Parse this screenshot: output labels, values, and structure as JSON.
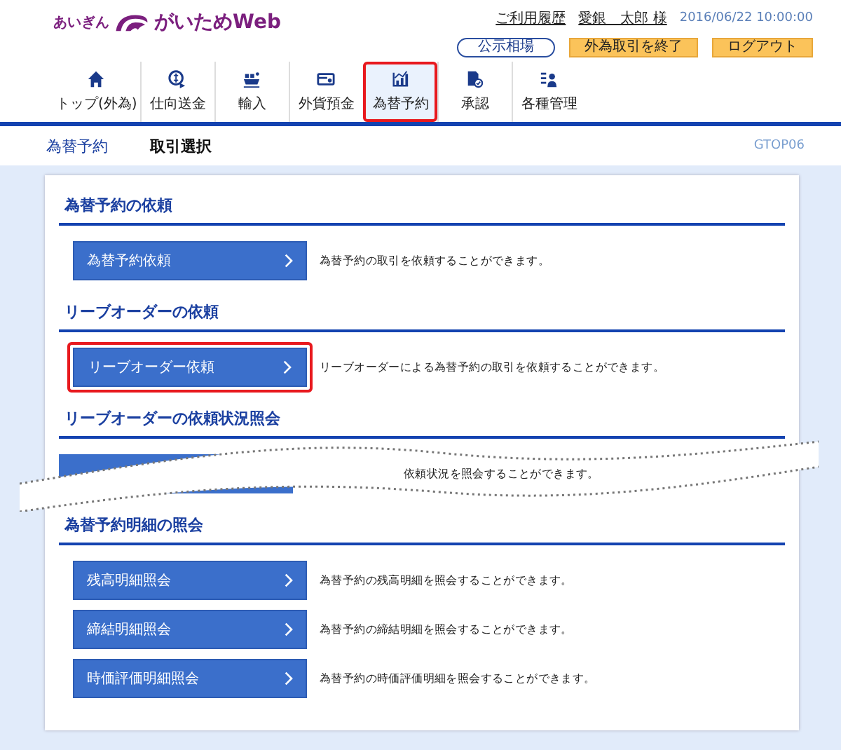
{
  "header": {
    "logo_small": "あいぎん",
    "logo_main": "がいためWeb",
    "links": [
      "ご利用履歴",
      "愛銀　太郎 様"
    ],
    "datetime": "2016/06/22 10:00:00",
    "buttons": [
      {
        "label": "公示相場",
        "kind": "outline"
      },
      {
        "label": "外為取引を終了",
        "kind": "orange"
      },
      {
        "label": "ログアウト",
        "kind": "orange"
      }
    ]
  },
  "nav": [
    {
      "label": "トップ(外為)",
      "selected": false,
      "highlighted": false
    },
    {
      "label": "仕向送金",
      "selected": false,
      "highlighted": false
    },
    {
      "label": "輸入",
      "selected": false,
      "highlighted": false
    },
    {
      "label": "外貨預金",
      "selected": false,
      "highlighted": false
    },
    {
      "label": "為替予約",
      "selected": true,
      "highlighted": true
    },
    {
      "label": "承認",
      "selected": false,
      "highlighted": false
    },
    {
      "label": "各種管理",
      "selected": false,
      "highlighted": false
    }
  ],
  "breadcrumb": {
    "section": "為替予約",
    "page": "取引選択",
    "screen_id": "GTOP06"
  },
  "sections": [
    {
      "title": "為替予約の依頼",
      "kind": "normal",
      "items": [
        {
          "label": "為替予約依頼",
          "description": "為替予約の取引を依頼することができます。",
          "highlighted": false
        }
      ]
    },
    {
      "title": "リーブオーダーの依頼",
      "kind": "normal",
      "items": [
        {
          "label": "リーブオーダー依頼",
          "description": "リーブオーダーによる為替予約の取引を依頼することができます。",
          "highlighted": true
        }
      ]
    },
    {
      "title": "リーブオーダーの依頼状況照会",
      "kind": "torn",
      "items": [
        {
          "description": "依頼状況を照会することができます。"
        }
      ]
    },
    {
      "title": "為替予約明細の照会",
      "kind": "normal",
      "items": [
        {
          "label": "残高明細照会",
          "description": "為替予約の残高明細を照会することができます。",
          "highlighted": false
        },
        {
          "label": "締結明細照会",
          "description": "為替予約の締結明細を照会することができます。",
          "highlighted": false
        },
        {
          "label": "時価評価明細照会",
          "description": "為替予約の時価評価明細を照会することができます。",
          "highlighted": false
        }
      ]
    }
  ]
}
